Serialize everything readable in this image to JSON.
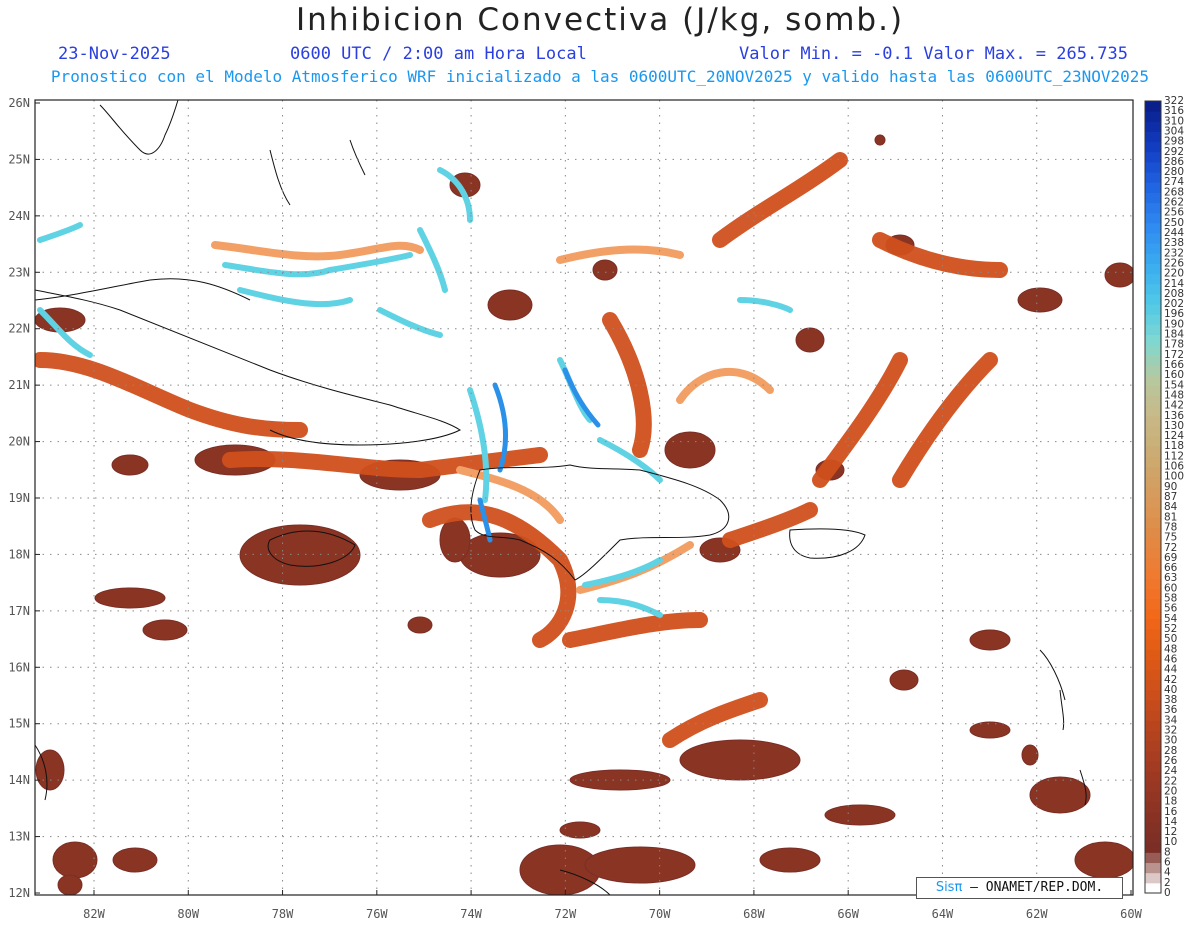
{
  "title": "Inhibicion Convectiva (J/kg, somb.)",
  "header": {
    "date": "23-Nov-2025",
    "time": "0600 UTC / 2:00 am Hora Local",
    "minmax": "Valor Min. = -0.1  Valor Max. = 265.735"
  },
  "subtitle": "Pronostico con el Modelo Atmosferico WRF inicializado a las 0600UTC_20NOV2025 y valido hasta las  0600UTC_23NOV2025",
  "credit": {
    "brand": "Sisπ",
    "text": "– ONAMET/REP.DOM."
  },
  "colorbar": {
    "labels": [
      "0",
      "2",
      "4",
      "6",
      "8",
      "10",
      "12",
      "14",
      "16",
      "18",
      "20",
      "22",
      "24",
      "26",
      "28",
      "30",
      "32",
      "34",
      "36",
      "38",
      "40",
      "42",
      "44",
      "46",
      "48",
      "50",
      "52",
      "54",
      "56",
      "58",
      "60",
      "63",
      "66",
      "69",
      "72",
      "75",
      "78",
      "81",
      "84",
      "87",
      "90",
      "100",
      "106",
      "112",
      "118",
      "124",
      "130",
      "136",
      "142",
      "148",
      "154",
      "160",
      "166",
      "172",
      "178",
      "184",
      "190",
      "196",
      "202",
      "208",
      "214",
      "220",
      "226",
      "232",
      "238",
      "244",
      "250",
      "256",
      "262",
      "268",
      "274",
      "280",
      "286",
      "292",
      "298",
      "304",
      "310",
      "316",
      "322"
    ],
    "stops": [
      "#ffffff",
      "#7a2e26",
      "#8c3324",
      "#a03a22",
      "#b5431f",
      "#cc4f1b",
      "#e05a15",
      "#f2691a",
      "#f07a30",
      "#e08a45",
      "#d89a5a",
      "#ccaa70",
      "#c8b886",
      "#b8c89e",
      "#7fd8d0",
      "#4ec8e8",
      "#3aaaf0",
      "#2f88f0",
      "#1f62e0",
      "#123cc0",
      "#0a1f8c"
    ]
  },
  "map": {
    "lat_labels": [
      "26N",
      "25N",
      "24N",
      "23N",
      "22N",
      "21N",
      "20N",
      "19N",
      "18N",
      "17N",
      "16N",
      "15N",
      "14N",
      "13N",
      "12N"
    ],
    "lon_labels": [
      "82W",
      "80W",
      "78W",
      "76W",
      "74W",
      "72W",
      "70W",
      "68W",
      "66W",
      "64W",
      "62W",
      "60W"
    ],
    "colors": {
      "frame": "#222222",
      "grid": "#888888",
      "coast": "#111111",
      "dark": "#8a3424",
      "mid": "#d0501d",
      "orange": "#f07a30",
      "tan": "#d9a96a",
      "cyan": "#5fd3e4",
      "blue": "#2a90e8"
    }
  }
}
